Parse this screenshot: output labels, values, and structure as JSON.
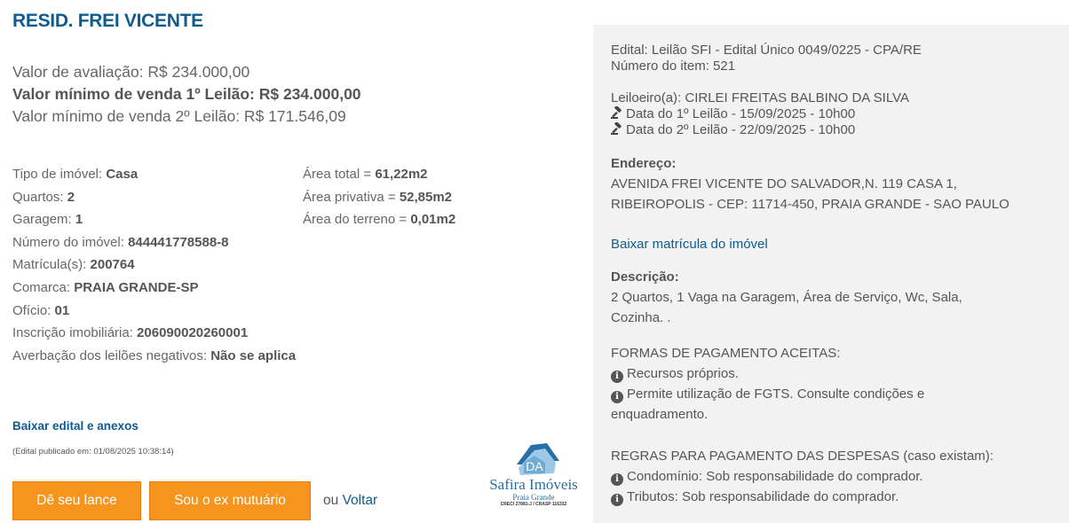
{
  "title": "RESID. FREI VICENTE",
  "valores": {
    "avaliacao": "Valor de avaliação: R$ 234.000,00",
    "minimo_1": "Valor mínimo de venda 1º Leilão: R$ 234.000,00",
    "minimo_2": "Valor mínimo de venda 2º Leilão: R$ 171.546,09"
  },
  "info_left": [
    {
      "label": "Tipo de imóvel: ",
      "value": "Casa"
    },
    {
      "label": "Quartos: ",
      "value": "2"
    },
    {
      "label": "Garagem: ",
      "value": "1"
    },
    {
      "label": "Número do imóvel: ",
      "value": "844441778588-8"
    },
    {
      "label": "Matrícula(s): ",
      "value": "200764"
    },
    {
      "label": "Comarca: ",
      "value": "PRAIA GRANDE-SP"
    },
    {
      "label": "Ofício: ",
      "value": "01"
    },
    {
      "label": "Inscrição imobiliária: ",
      "value": "206090020260001"
    },
    {
      "label": "Averbação dos leilões negativos: ",
      "value": "Não se aplica"
    }
  ],
  "info_right": [
    {
      "label": "Área total = ",
      "value": "61,22m2"
    },
    {
      "label": "Área privativa = ",
      "value": "52,85m2"
    },
    {
      "label": "Área do terreno = ",
      "value": "0,01m2"
    }
  ],
  "links": {
    "baixar_edital": "Baixar edital e anexos",
    "publicado": "(Edital publicado em: 01/08/2025 10:38:14)",
    "ou": "ou ",
    "voltar": "Voltar"
  },
  "buttons": {
    "lance": "Dê seu lance",
    "mutuario": "Sou o ex mutuário"
  },
  "logo": {
    "initials": "DA",
    "name": "Safira Imóveis",
    "sub": "Praia Grande",
    "creci": "CRECI 27881-J / CRASP 116332"
  },
  "panel": {
    "edital": "Edital: Leilão SFI - Edital Único 0049/0225 - CPA/RE",
    "numero_item": "Número do item: 521",
    "leiloeiro": "Leiloeiro(a): CIRLEI FREITAS BALBINO DA SILVA",
    "data_1": "Data do 1º Leilão - 15/09/2025 - 10h00",
    "data_2": "Data do 2º Leilão - 22/09/2025 - 10h00",
    "endereco_label": "Endereço:",
    "endereco_1": "AVENIDA FREI VICENTE DO SALVADOR,N. 119 CASA 1,",
    "endereco_2": "RIBEIROPOLIS - CEP: 11714-450, PRAIA GRANDE - SAO PAULO",
    "baixar_matricula": "Baixar matrícula do imóvel",
    "descricao_label": "Descrição:",
    "descricao_1": "2 Quartos, 1 Vaga na Garagem, Área de Serviço, Wc, Sala,",
    "descricao_2": "Cozinha. .",
    "formas_label": "FORMAS DE PAGAMENTO ACEITAS:",
    "forma_1": "Recursos próprios.",
    "forma_2a": "Permite utilização de FGTS. Consulte condições e",
    "forma_2b": "enquadramento.",
    "regras_label": "REGRAS PARA PAGAMENTO DAS DESPESAS (caso existam):",
    "regra_1": "Condomínio: Sob responsabilidade do comprador.",
    "regra_2": "Tributos: Sob responsabilidade do comprador."
  },
  "icons": {
    "gavel": "gavel-icon",
    "info": "info-circle-icon",
    "brand_color": "#0e5c8f",
    "button_color": "#f7941d",
    "panel_bg": "#f2f2f2"
  }
}
